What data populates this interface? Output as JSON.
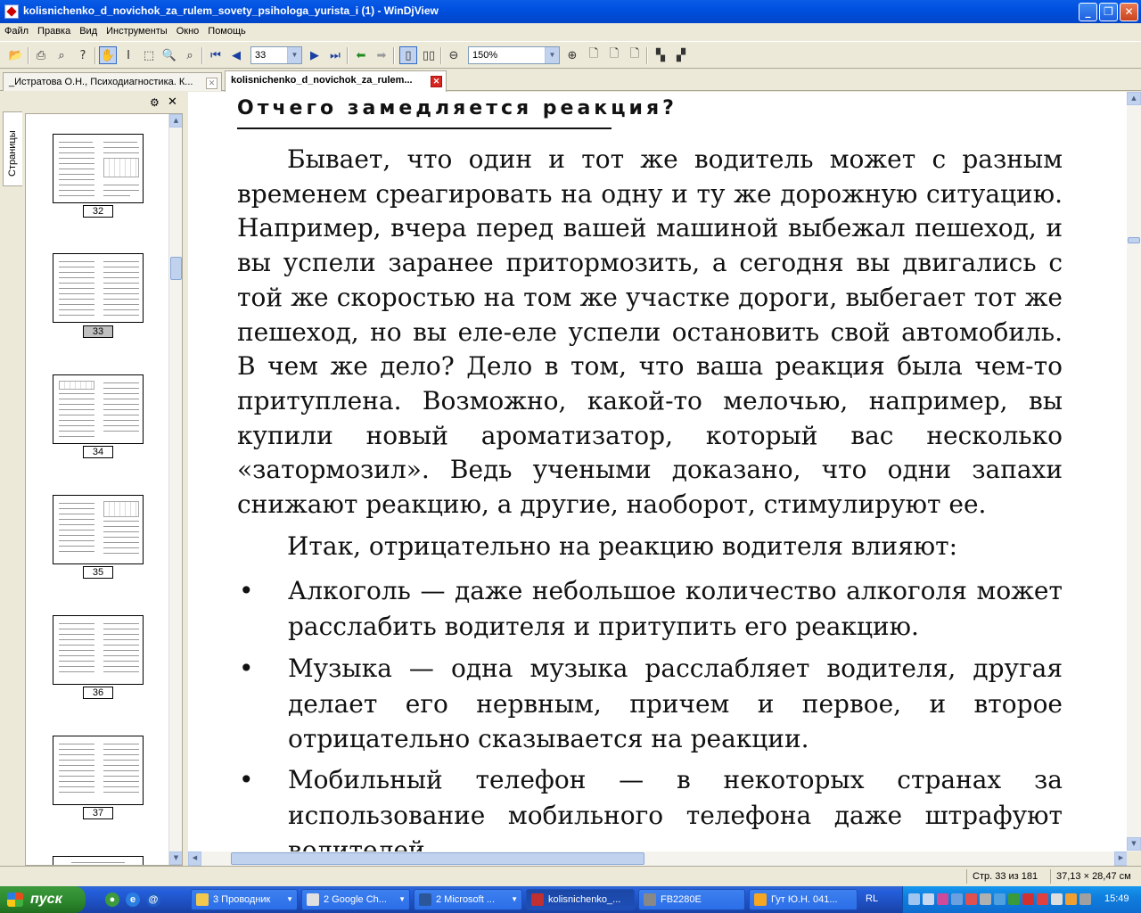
{
  "window": {
    "title": "kolisnichenko_d_novichok_za_rulem_sovety_psihologa_yurista_i (1) - WinDjView",
    "minimize": "_",
    "maximize": "❐",
    "close": "✕"
  },
  "menu": [
    "Файл",
    "Правка",
    "Вид",
    "Инструменты",
    "Окно",
    "Помощь"
  ],
  "toolbar": {
    "page_number": "33",
    "zoom": "150%"
  },
  "tabs": [
    {
      "label": "_Истратова О.Н., Психодиагностика. К...",
      "active": false
    },
    {
      "label": "kolisnichenko_d_novichok_za_rulem...",
      "active": true
    }
  ],
  "sidebar": {
    "tab_label": "Страницы",
    "thumbnails": [
      {
        "page": "32",
        "selected": false
      },
      {
        "page": "33",
        "selected": true
      },
      {
        "page": "34",
        "selected": false
      },
      {
        "page": "35",
        "selected": false
      },
      {
        "page": "36",
        "selected": false
      },
      {
        "page": "37",
        "selected": false
      }
    ]
  },
  "document": {
    "heading": "Отчего замедляется реакция?",
    "paragraph1": "Бывает, что один и тот же водитель может с разным временем среагировать на одну и ту же дорожную ситуацию. Например, вчера перед вашей машиной выбежал пешеход, и вы успели заранее притормозить, а сегодня вы двигались с той же скоростью на том же участке дороги, выбегает тот же пешеход, но вы еле-еле успели остановить свой автомобиль. В чем же дело? Дело в том, что ваша реакция была чем-то притуплена. Возможно, какой-то мелочью, например, вы купили новый ароматизатор, который вас несколько «затормозил». Ведь учеными доказано, что одни запахи снижают реакцию, а другие, наоборот, стимулируют ее.",
    "paragraph2": "Итак, отрицательно на реакцию водителя влияют:",
    "bullet_char": "•",
    "bullets": [
      "Алкоголь — даже небольшое количество алкоголя может расслабить водителя и притупить его реакцию.",
      "Музыка — одна музыка расслабляет водителя, другая делает его нервным, причем и первое, и второе отрицательно сказывается на реакции.",
      "Мобильный телефон — в некоторых странах за использование мобильного телефона даже штрафуют водителей."
    ]
  },
  "status": {
    "page_info": "Стр. 33 из 181",
    "page_size": "37,13 × 28,47 см"
  },
  "taskbar": {
    "start_label": "пуск",
    "tasks": [
      {
        "label": "3 Проводник",
        "color": "#f2c94c"
      },
      {
        "label": "2 Google Ch...",
        "color": "#e0e0e0"
      },
      {
        "label": "2 Microsoft ...",
        "color": "#2b579a"
      },
      {
        "label": "kolisnichenko_...",
        "color": "#c03030"
      },
      {
        "label": "FB2280E",
        "color": "#888"
      },
      {
        "label": "Гут Ю.Н. 041...",
        "color": "#f5a623"
      }
    ],
    "language": "RL",
    "clock": "15:49"
  }
}
